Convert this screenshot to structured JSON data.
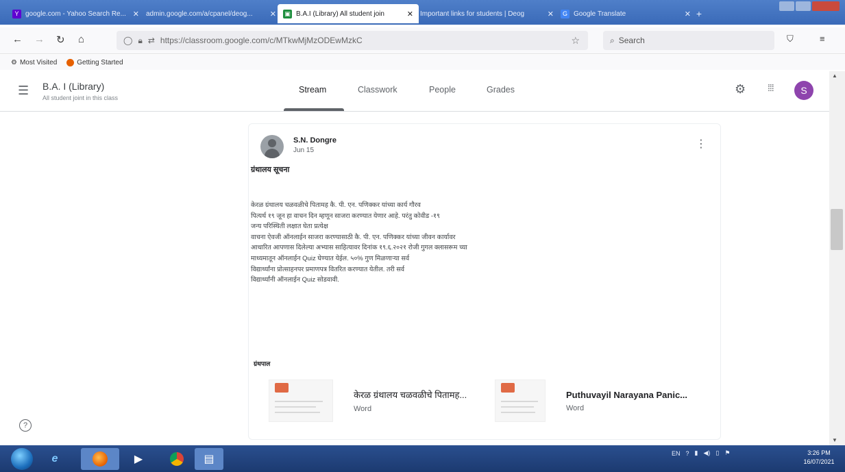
{
  "browser": {
    "tabs": [
      {
        "title": "google.com - Yahoo Search Re...",
        "favicon": "yahoo-icon",
        "active": false
      },
      {
        "title": "admin.google.com/a/cpanel/deog...",
        "favicon": "none",
        "active": false
      },
      {
        "title": "B.A.I (Library) All student join",
        "favicon": "classroom-icon",
        "active": true
      },
      {
        "title": "Important links for students | Deog",
        "favicon": "none",
        "active": false
      },
      {
        "title": "Google Translate",
        "favicon": "translate-icon",
        "active": false
      }
    ],
    "url_domain": "https://classroom.google.com",
    "url_path": "/c/MTkwMjMzODEwMzkC",
    "search_placeholder": "Search",
    "bookmarks": [
      {
        "label": "Most Visited",
        "icon": "gear-icon"
      },
      {
        "label": "Getting Started",
        "icon": "firefox-icon"
      }
    ]
  },
  "classroom": {
    "class_title": "B.A. I (Library)",
    "class_subtitle": "All student joint in this class",
    "nav_tabs": [
      "Stream",
      "Classwork",
      "People",
      "Grades"
    ],
    "active_tab": "Stream",
    "avatar_letter": "S",
    "avatar_color": "#8e44ad"
  },
  "post": {
    "author": "S.N. Dongre",
    "date": "Jun 15",
    "title": "ग्रंथालय सूचना",
    "body_lines": [
      "केरळ ग्रंथालय चळवळीचे पितामह कै. पी. एन. पणिक्कर यांच्या कार्य गौरव",
      "पित्यर्थ १९ जून हा वाचन दिन म्हणून साजरा करण्यात येणार आहे. परंतु कोवीड -१९",
      "जन्य परिस्थिती लक्षात घेता प्रत्येक्ष",
      "वाचना ऐवजी ऑनलाईन साजरा करण्यासाठी कै. पी. एन. पणिक्कर यांच्या जीवन कार्यावर",
      "आधारित आपणास दिलेल्या अभ्यास साहित्यावर दिनांक १९.६.२०२१ रोजी गुगल क्लासरूम च्या",
      "माध्यमातून ऑनलाईन Quiz घेण्यात येईल. ५०% गुण मिळणाऱ्या सर्व",
      "विद्यार्थ्यांना प्रोत्साहनपर प्रमाणपत्र वितरित करण्यात येतील. तरी सर्व",
      "विद्यार्थ्यांनी ऑनलाईन Quiz सोडवावी."
    ],
    "attachments_label": "ग्रंथपाल",
    "attachments": [
      {
        "name": "केरळ ग्रंथालय चळवळीचे पितामह...",
        "type": "Word"
      },
      {
        "name": "Puthuvayil Narayana Panic...",
        "type": "Word"
      }
    ]
  },
  "taskbar": {
    "apps": [
      "ie-icon",
      "firefox-icon",
      "media-icon",
      "chrome-icon",
      "office-icon"
    ],
    "clock_time": "3:26 PM",
    "clock_date": "16/07/2021"
  }
}
